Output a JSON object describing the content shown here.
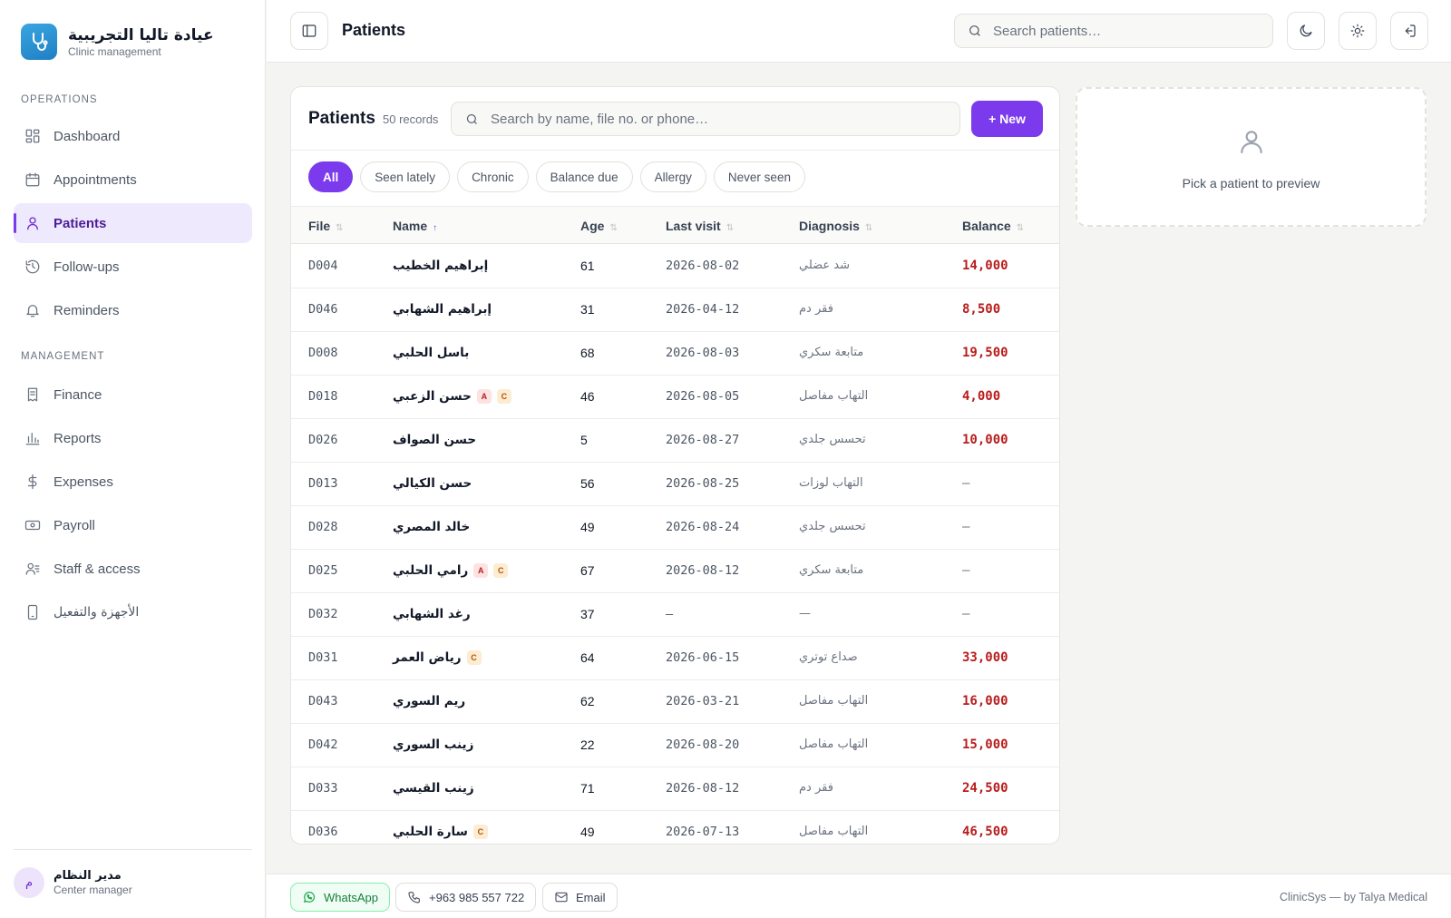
{
  "brand": {
    "title": "عيادة تاليا التجريبية",
    "subtitle": "Clinic management"
  },
  "sidebar": {
    "operations_label": "OPERATIONS",
    "management_label": "MANAGEMENT",
    "operations": [
      {
        "label": "Dashboard",
        "icon": "grid-icon"
      },
      {
        "label": "Appointments",
        "icon": "calendar-icon"
      },
      {
        "label": "Patients",
        "icon": "user-icon",
        "active": true
      },
      {
        "label": "Follow-ups",
        "icon": "history-icon"
      },
      {
        "label": "Reminders",
        "icon": "bell-icon"
      }
    ],
    "management": [
      {
        "label": "Finance",
        "icon": "receipt-icon"
      },
      {
        "label": "Reports",
        "icon": "bar-chart-icon"
      },
      {
        "label": "Expenses",
        "icon": "dollar-icon"
      },
      {
        "label": "Payroll",
        "icon": "banknote-icon"
      },
      {
        "label": "Staff & access",
        "icon": "users-icon"
      },
      {
        "label": "الأجهزة والتفعيل",
        "icon": "phone-icon"
      }
    ],
    "user": {
      "initial": "م",
      "name": "مدير النظام",
      "role": "Center manager"
    }
  },
  "topbar": {
    "title": "Patients",
    "search_placeholder": "Search patients…"
  },
  "patients": {
    "title": "Patients",
    "count": "50 records",
    "search_placeholder": "Search by name, file no. or phone…",
    "new_label": "+ New",
    "filters": [
      "All",
      "Seen lately",
      "Chronic",
      "Balance due",
      "Allergy",
      "Never seen"
    ],
    "active_filter": "All",
    "columns": {
      "file": "File",
      "name": "Name",
      "age": "Age",
      "last_visit": "Last visit",
      "diagnosis": "Diagnosis",
      "balance": "Balance"
    },
    "rows": [
      {
        "file": "D004",
        "name": "إبراهيم الخطيب",
        "tags": [],
        "age": "61",
        "last_visit": "2026-08-02",
        "diagnosis": "شد عضلي",
        "balance": "14,000",
        "due": true
      },
      {
        "file": "D046",
        "name": "إبراهيم الشهابي",
        "tags": [],
        "age": "31",
        "last_visit": "2026-04-12",
        "diagnosis": "فقر دم",
        "balance": "8,500",
        "due": true
      },
      {
        "file": "D008",
        "name": "باسل الحلبي",
        "tags": [],
        "age": "68",
        "last_visit": "2026-08-03",
        "diagnosis": "متابعة سكري",
        "balance": "19,500",
        "due": true
      },
      {
        "file": "D018",
        "name": "حسن الزعبي",
        "tags": [
          "A",
          "C"
        ],
        "age": "46",
        "last_visit": "2026-08-05",
        "diagnosis": "التهاب مفاصل",
        "balance": "4,000",
        "due": true
      },
      {
        "file": "D026",
        "name": "حسن الصواف",
        "tags": [],
        "age": "5",
        "last_visit": "2026-08-27",
        "diagnosis": "تحسس جلدي",
        "balance": "10,000",
        "due": true
      },
      {
        "file": "D013",
        "name": "حسن الكيالي",
        "tags": [],
        "age": "56",
        "last_visit": "2026-08-25",
        "diagnosis": "التهاب لوزات",
        "balance": "–",
        "due": false
      },
      {
        "file": "D028",
        "name": "خالد المصري",
        "tags": [],
        "age": "49",
        "last_visit": "2026-08-24",
        "diagnosis": "تحسس جلدي",
        "balance": "–",
        "due": false
      },
      {
        "file": "D025",
        "name": "رامي الحلبي",
        "tags": [
          "A",
          "C"
        ],
        "age": "67",
        "last_visit": "2026-08-12",
        "diagnosis": "متابعة سكري",
        "balance": "–",
        "due": false
      },
      {
        "file": "D032",
        "name": "رغد الشهابي",
        "tags": [],
        "age": "37",
        "last_visit": "–",
        "diagnosis": "—",
        "balance": "–",
        "due": false
      },
      {
        "file": "D031",
        "name": "رياض العمر",
        "tags": [
          "C"
        ],
        "age": "64",
        "last_visit": "2026-06-15",
        "diagnosis": "صداع توتري",
        "balance": "33,000",
        "due": true
      },
      {
        "file": "D043",
        "name": "ريم السوري",
        "tags": [],
        "age": "62",
        "last_visit": "2026-03-21",
        "diagnosis": "التهاب مفاصل",
        "balance": "16,000",
        "due": true
      },
      {
        "file": "D042",
        "name": "زينب السوري",
        "tags": [],
        "age": "22",
        "last_visit": "2026-08-20",
        "diagnosis": "التهاب مفاصل",
        "balance": "15,000",
        "due": true
      },
      {
        "file": "D033",
        "name": "زينب القيسي",
        "tags": [],
        "age": "71",
        "last_visit": "2026-08-12",
        "diagnosis": "فقر دم",
        "balance": "24,500",
        "due": true
      },
      {
        "file": "D036",
        "name": "سارة الحلبي",
        "tags": [
          "C"
        ],
        "age": "49",
        "last_visit": "2026-07-13",
        "diagnosis": "التهاب مفاصل",
        "balance": "46,500",
        "due": true
      }
    ]
  },
  "preview": {
    "text": "Pick a patient to preview"
  },
  "footer": {
    "whatsapp": "WhatsApp",
    "phone": "+963 985 557 722",
    "email": "Email",
    "credit": "ClinicSys — by Talya Medical"
  },
  "colors": {
    "accent": "#7c3aed",
    "balance_due": "#b91c1c",
    "whatsapp": "#16a34a"
  }
}
